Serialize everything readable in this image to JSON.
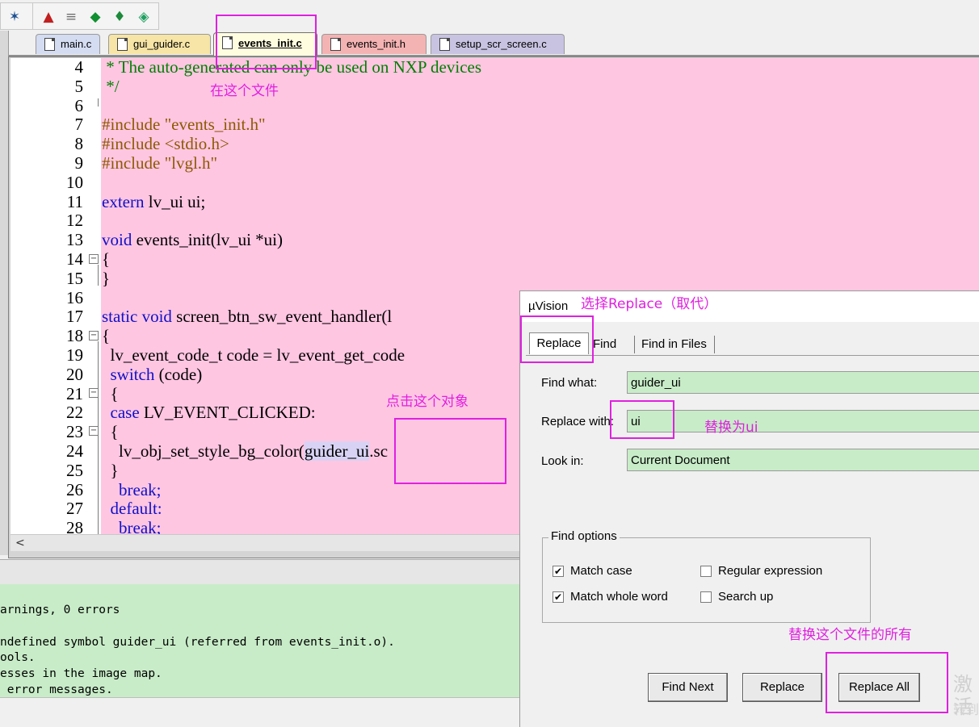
{
  "tabs": [
    {
      "label": "main.c",
      "color": "#d4dcf2"
    },
    {
      "label": "gui_guider.c",
      "color": "#f6e5a6"
    },
    {
      "label": "events_init.c",
      "color": "#fffde0",
      "active": true
    },
    {
      "label": "events_init.h",
      "color": "#f4b3b3"
    },
    {
      "label": "setup_scr_screen.c",
      "color": "#c9c3e2"
    }
  ],
  "editor": {
    "line_numbers": [
      "4",
      "5",
      "6",
      "7",
      "8",
      "9",
      "10",
      "11",
      "12",
      "13",
      "14",
      "15",
      "16",
      "17",
      "18",
      "19",
      "20",
      "21",
      "22",
      "23",
      "24",
      "25",
      "26",
      "27",
      "28"
    ],
    "lines": [
      [
        {
          "t": " * The auto-generated can only be used on NXP devices",
          "c": "c-com"
        }
      ],
      [
        {
          "t": " */",
          "c": "c-com"
        }
      ],
      [],
      [
        {
          "t": "#include ",
          "c": "c-pp"
        },
        {
          "t": "\"events_init.h\"",
          "c": "c-str"
        }
      ],
      [
        {
          "t": "#include ",
          "c": "c-pp"
        },
        {
          "t": "<stdio.h>",
          "c": "c-str"
        }
      ],
      [
        {
          "t": "#include ",
          "c": "c-pp"
        },
        {
          "t": "\"lvgl.h\"",
          "c": "c-str"
        }
      ],
      [],
      [
        {
          "t": "extern ",
          "c": "c-kw"
        },
        {
          "t": "lv_ui ui;",
          "c": "c-txt"
        }
      ],
      [],
      [
        {
          "t": "void ",
          "c": "c-kw"
        },
        {
          "t": "events_init(lv_ui *ui)",
          "c": "c-txt"
        }
      ],
      [
        {
          "t": "{",
          "c": "c-txt"
        }
      ],
      [
        {
          "t": "}",
          "c": "c-txt"
        }
      ],
      [],
      [
        {
          "t": "static void ",
          "c": "c-kw"
        },
        {
          "t": "screen_btn_sw_event_handler(l",
          "c": "c-txt"
        }
      ],
      [
        {
          "t": "{",
          "c": "c-txt"
        }
      ],
      [
        {
          "t": "  lv_event_code_t code = lv_event_get_code",
          "c": "c-txt"
        }
      ],
      [
        {
          "t": "  switch ",
          "c": "c-kw"
        },
        {
          "t": "(code)",
          "c": "c-txt"
        }
      ],
      [
        {
          "t": "  {",
          "c": "c-txt"
        }
      ],
      [
        {
          "t": "  case ",
          "c": "c-kw"
        },
        {
          "t": "LV_EVENT_CLICKED:",
          "c": "c-txt"
        }
      ],
      [
        {
          "t": "  {",
          "c": "c-txt"
        }
      ],
      [
        {
          "t": "    lv_obj_set_style_bg_color(",
          "c": "c-txt"
        },
        {
          "t": "guider_ui",
          "c": "c-txt hl"
        },
        {
          "t": ".sc",
          "c": "c-txt"
        }
      ],
      [
        {
          "t": "  }",
          "c": "c-txt"
        }
      ],
      [
        {
          "t": "    break;",
          "c": "c-kw"
        }
      ],
      [
        {
          "t": "  default:",
          "c": "c-kw"
        }
      ],
      [
        {
          "t": "    break;",
          "c": "c-kw"
        }
      ]
    ]
  },
  "output": {
    "lines": [
      "arnings, 0 errors",
      "",
      "ndefined symbol guider_ui (referred from events_init.o).",
      "ools.",
      "esses in the image map.",
      " error messages."
    ]
  },
  "dialog": {
    "title": "µVision",
    "tabs": [
      "Replace",
      "Find",
      "Find in Files"
    ],
    "find_what_label": "Find what:",
    "find_what_value": "guider_ui",
    "replace_with_label": "Replace with:",
    "replace_with_value": "ui",
    "look_in_label": "Look in:",
    "look_in_value": "Current Document",
    "find_options_title": "Find options",
    "options": {
      "match_case": {
        "label": "Match case",
        "checked": true
      },
      "match_whole_word": {
        "label": "Match whole word",
        "checked": true
      },
      "regular_expression": {
        "label": "Regular expression",
        "checked": false
      },
      "search_up": {
        "label": "Search up",
        "checked": false
      }
    },
    "buttons": {
      "find_next": "Find Next",
      "replace": "Replace",
      "replace_all": "Replace All"
    }
  },
  "watermark": {
    "line1": "激活",
    "line2": "转到"
  },
  "annotations": {
    "file_note": "在这个文件",
    "select_replace": "选择Replace（取代）",
    "click_object": "点击这个对象",
    "replace_to": "替换为ui",
    "replace_all_note": "替换这个文件的所有"
  },
  "annotation_color": "#e020e0"
}
